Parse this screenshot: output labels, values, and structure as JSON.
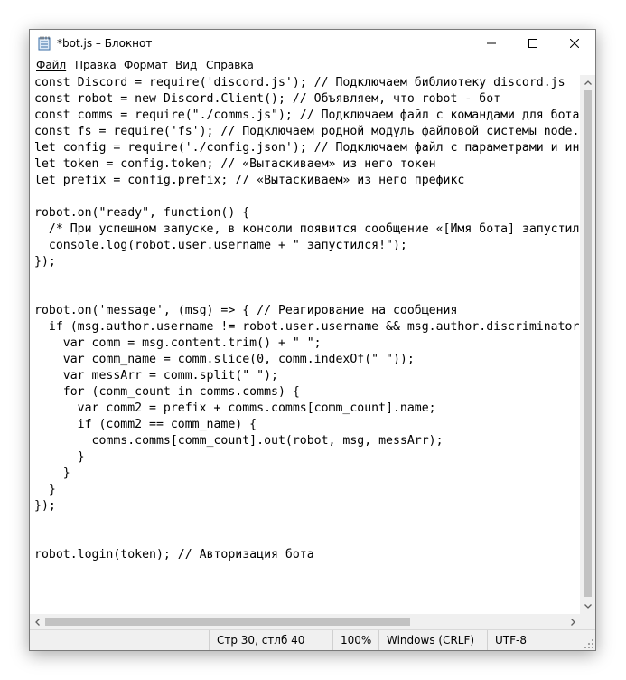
{
  "window": {
    "title": "*bot.js – Блокнот"
  },
  "menu": [
    "Файл",
    "Правка",
    "Формат",
    "Вид",
    "Справка"
  ],
  "menu_underline": [
    "Ф",
    "П",
    "р",
    "В",
    "С"
  ],
  "editor": {
    "lines": [
      "const Discord = require('discord.js'); // Подключаем библиотеку discord.js",
      "const robot = new Discord.Client(); // Объявляем, что robot - бот",
      "const comms = require(\"./comms.js\"); // Подключаем файл с командами для бота",
      "const fs = require('fs'); // Подключаем родной модуль файловой системы node.js",
      "let config = require('./config.json'); // Подключаем файл с параметрами и информацией",
      "let token = config.token; // «Вытаскиваем» из него токен",
      "let prefix = config.prefix; // «Вытаскиваем» из него префикс",
      "",
      "robot.on(\"ready\", function() {",
      "  /* При успешном запуске, в консоли появится сообщение «[Имя бота] запустился!» */",
      "  console.log(robot.user.username + \" запустился!\");",
      "});",
      "",
      "",
      "robot.on('message', (msg) => { // Реагирование на сообщения",
      "  if (msg.author.username != robot.user.username && msg.author.discriminator != robot.user.discriminator) {",
      "    var comm = msg.content.trim() + \" \";",
      "    var comm_name = comm.slice(0, comm.indexOf(\" \"));",
      "    var messArr = comm.split(\" \");",
      "    for (comm_count in comms.comms) {",
      "      var comm2 = prefix + comms.comms[comm_count].name;",
      "      if (comm2 == comm_name) {",
      "        comms.comms[comm_count].out(robot, msg, messArr);",
      "      }",
      "    }",
      "  }",
      "});",
      "",
      "",
      "robot.login(token); // Авторизация бота"
    ]
  },
  "status": {
    "position": "Стр 30, стлб 40",
    "zoom": "100%",
    "line_endings": "Windows (CRLF)",
    "encoding": "UTF-8"
  },
  "icons": {
    "app": "notepad-icon",
    "minimize": "minimize-icon",
    "maximize": "maximize-icon",
    "close": "close-icon"
  }
}
